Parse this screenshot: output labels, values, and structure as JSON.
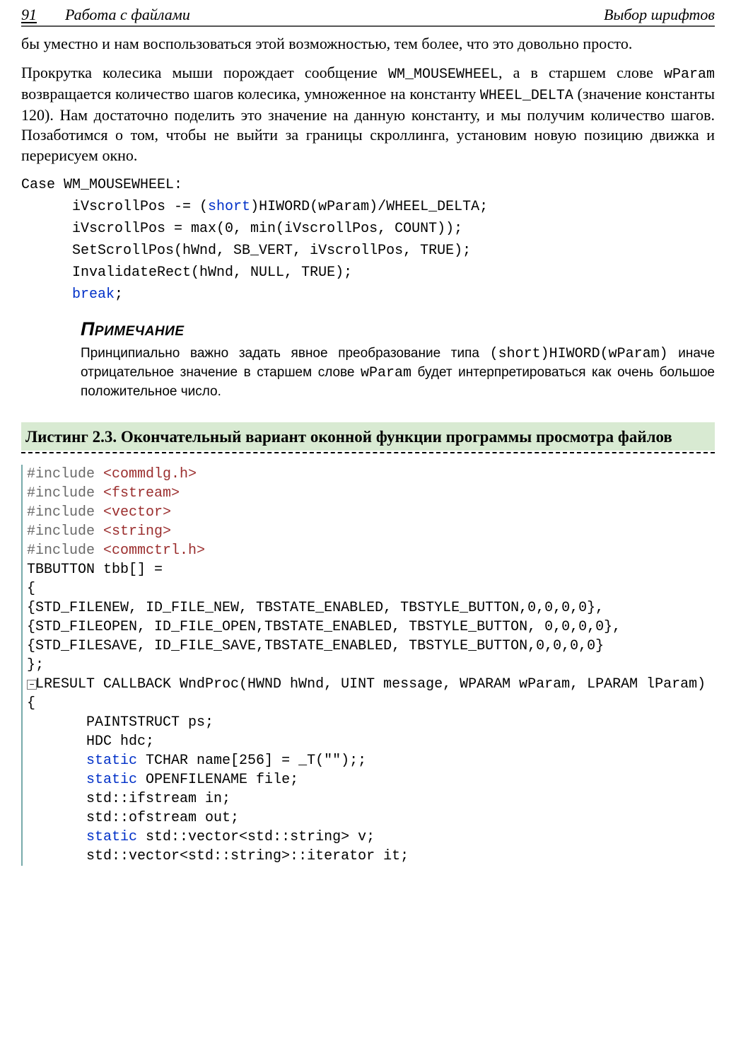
{
  "header": {
    "page_number": "91",
    "section_left": "Работа с файлами",
    "section_right": "Выбор шрифтов"
  },
  "para1": "бы уместно и нам воспользоваться этой возможностью, тем более, что это довольно просто.",
  "para2_parts": {
    "t1": "Прокрутка колесика мыши порождает сообщение ",
    "c1": "WM_MOUSEWHEEL",
    "t2": ", а в старшем слове ",
    "c2": "wParam",
    "t3": " возвращается количество шагов колесика, умноженное на константу ",
    "c3": "WHEEL_DELTA",
    "t4": " (значение константы 120). Нам достаточно поделить это значение на данную константу, и мы получим количество шагов. Позаботимся о том, чтобы не выйти за границы скроллинга, установим новую позицию движка и перерисуем окно."
  },
  "code1": {
    "l1a": "Case WM_MOUSEWHEEL:",
    "l2a": "      iVscrollPos -= (",
    "l2b": "short",
    "l2c": ")HIWORD(wParam)/WHEEL_DELTA;",
    "l3": "      iVscrollPos = max(0, min(iVscrollPos, COUNT));",
    "l4": "      SetScrollPos(hWnd, SB_VERT, iVscrollPos, TRUE);",
    "l5": "      InvalidateRect(hWnd, NULL, TRUE);",
    "l6a": "      ",
    "l6b": "break",
    "l6c": ";"
  },
  "note": {
    "heading": "Примечание",
    "t1": "Принципиально важно задать явное преобразование типа ",
    "c1": "(short)HIWORD(wParam)",
    "t2": " иначе отрицательное значение в старшем слове ",
    "c2": "wParam",
    "t3": " будет интерпретироваться как очень большое положительное число."
  },
  "listing": {
    "title": "Листинг 2.3. Окончательный вариант оконной функции программы просмотра файлов"
  },
  "code2": {
    "inc_kw": "#include",
    "inc1": " <commdlg.h>",
    "inc2": " <fstream>",
    "inc3": " <vector>",
    "inc4": " <string>",
    "inc5": " <commctrl.h>",
    "l_tbb1": "TBBUTTON tbb[] =",
    "l_tbb2": "{",
    "l_tbb3": "{STD_FILENEW, ID_FILE_NEW, TBSTATE_ENABLED, TBSTYLE_BUTTON,0,0,0,0},",
    "l_tbb4": "{STD_FILEOPEN, ID_FILE_OPEN,TBSTATE_ENABLED, TBSTYLE_BUTTON, 0,0,0,0},",
    "l_tbb5": "{STD_FILESAVE, ID_FILE_SAVE,TBSTATE_ENABLED, TBSTYLE_BUTTON,0,0,0,0}",
    "l_tbb6": "};",
    "fold": "−",
    "l_fn": "LRESULT CALLBACK WndProc(HWND hWnd, UINT message, WPARAM wParam, LPARAM lParam)",
    "l_br": "{",
    "l_b1": "       PAINTSTRUCT ps;",
    "l_b2": "       HDC hdc;",
    "l_b3a": "       ",
    "kw_static": "static",
    "l_b3b": " TCHAR name[256] = _T(\"\");;",
    "l_b4b": " OPENFILENAME file;",
    "l_b5": "       std::ifstream in;",
    "l_b6": "       std::ofstream out;",
    "l_b7b": " std::vector<std::string> v;",
    "l_b8": "       std::vector<std::string>::iterator it;"
  }
}
